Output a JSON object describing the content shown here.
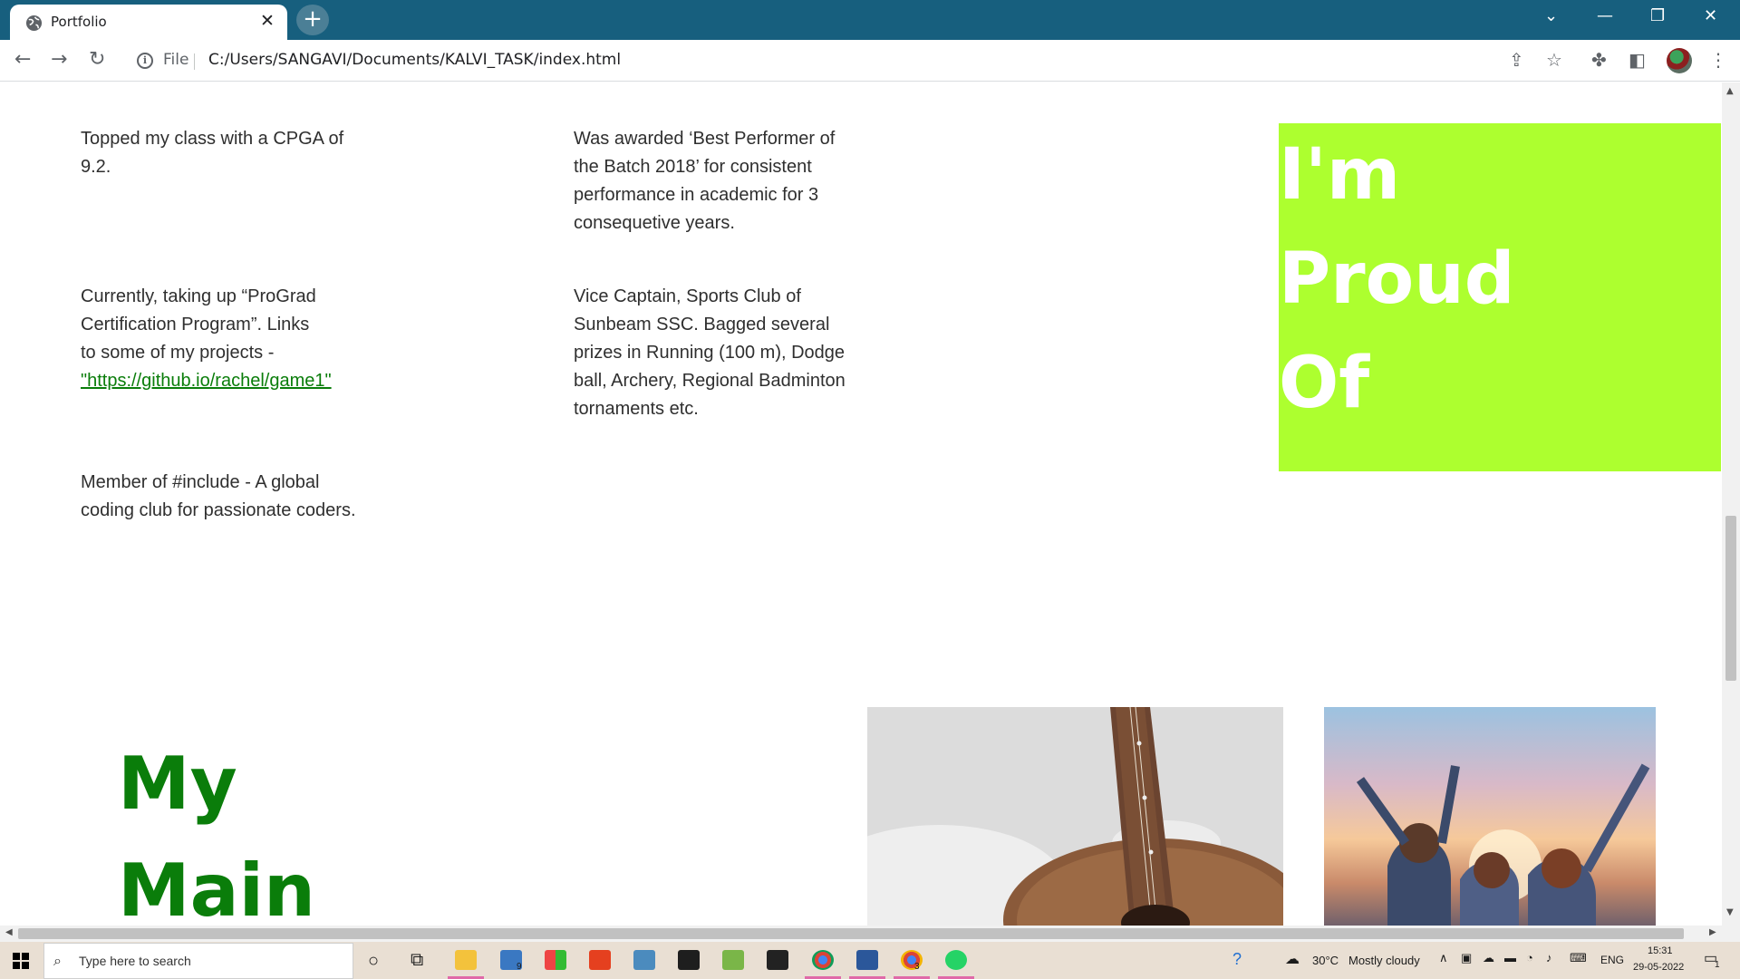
{
  "browser": {
    "tab_title": "Portfolio",
    "tab_close": "✕",
    "new_tab": "+",
    "scheme_label": "File",
    "url": "C:/Users/SANGAVI/Documents/KALVI_TASK/index.html"
  },
  "window_controls": {
    "dropdown": "⌄",
    "minimize": "—",
    "restore": "❐",
    "close": "✕"
  },
  "page": {
    "col1": {
      "item1": [
        "Topped my class with a CPGA of",
        "9.2."
      ],
      "item2_lines": [
        "Currently, taking up “ProGrad",
        "Certification Program”. Links",
        "to some of my projects -"
      ],
      "item2_link": "\"https://github.io/rachel/game1\"",
      "item3": [
        "Member of #include - A global",
        "coding club for passionate coders."
      ]
    },
    "col2": {
      "item1": [
        "Was awarded ‘Best Performer of",
        "the Batch 2018’ for consistent",
        "performance in academic for 3",
        "consequetive years."
      ],
      "item2": [
        "Vice Captain, Sports Club of",
        "Sunbeam SSC. Bagged several",
        "prizes in Running (100 m), Dodge",
        "ball, Archery, Regional Badminton",
        "tornaments etc."
      ]
    },
    "proud_heading": [
      "I'm",
      "Proud",
      "Of"
    ],
    "main_heading": [
      "My",
      "Main"
    ],
    "colors": {
      "accent_green": "#0a7d0a",
      "proud_bg": "#adff2f"
    }
  },
  "taskbar": {
    "search_placeholder": "Type here to search",
    "mail_badge": "9",
    "chrome_badge": "3",
    "temperature": "30°C",
    "weather": "Mostly cloudy",
    "language": "ENG",
    "time": "15:31",
    "date": "29-05-2022",
    "notification_count": "1"
  }
}
